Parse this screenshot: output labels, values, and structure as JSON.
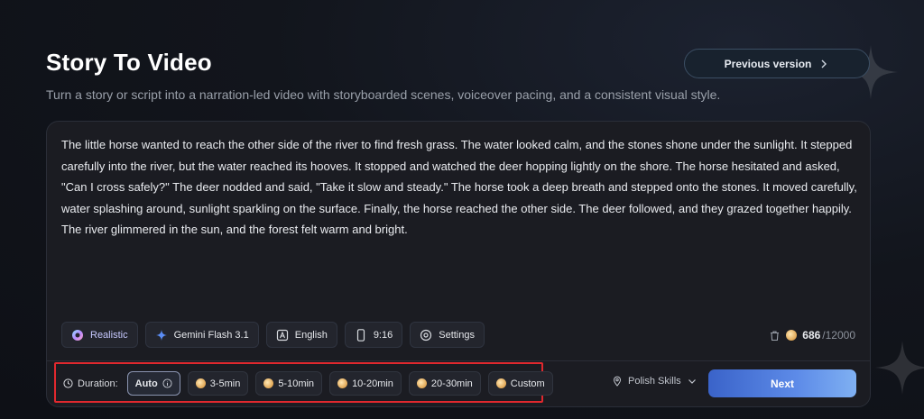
{
  "header": {
    "title": "Story To Video",
    "subtitle": "Turn a story or script into a narration-led video with storyboarded scenes, voiceover pacing, and a consistent visual style.",
    "previous_version_label": "Previous version"
  },
  "story_text": "The little horse wanted to reach the other side of the river to find fresh grass. The water looked calm, and the stones shone under the sunlight. It stepped carefully into the river, but the water reached its hooves. It stopped and watched the deer hopping lightly on the shore. The horse hesitated and asked, \"Can I cross safely?\" The deer nodded and said, \"Take it slow and steady.\" The horse took a deep breath and stepped onto the stones. It moved carefully, water splashing around, sunlight sparkling on the surface. Finally, the horse reached the other side. The deer followed, and they grazed together happily. The river glimmered in the sun, and the forest felt warm and bright.",
  "options": {
    "style": "Realistic",
    "model": "Gemini Flash 3.1",
    "language": "English",
    "aspect_ratio": "9:16",
    "settings": "Settings"
  },
  "credits": {
    "count": "686",
    "max": "/12000"
  },
  "duration": {
    "label": "Duration:",
    "options": [
      "Auto",
      "3-5min",
      "5-10min",
      "10-20min",
      "20-30min",
      "Custom"
    ],
    "selected": "Auto"
  },
  "polish_skills": "Polish Skills",
  "next_label": "Next",
  "colors": {
    "accent": "#5d8be8",
    "highlight_box": "#e0282e",
    "coin": "#e0a553"
  }
}
